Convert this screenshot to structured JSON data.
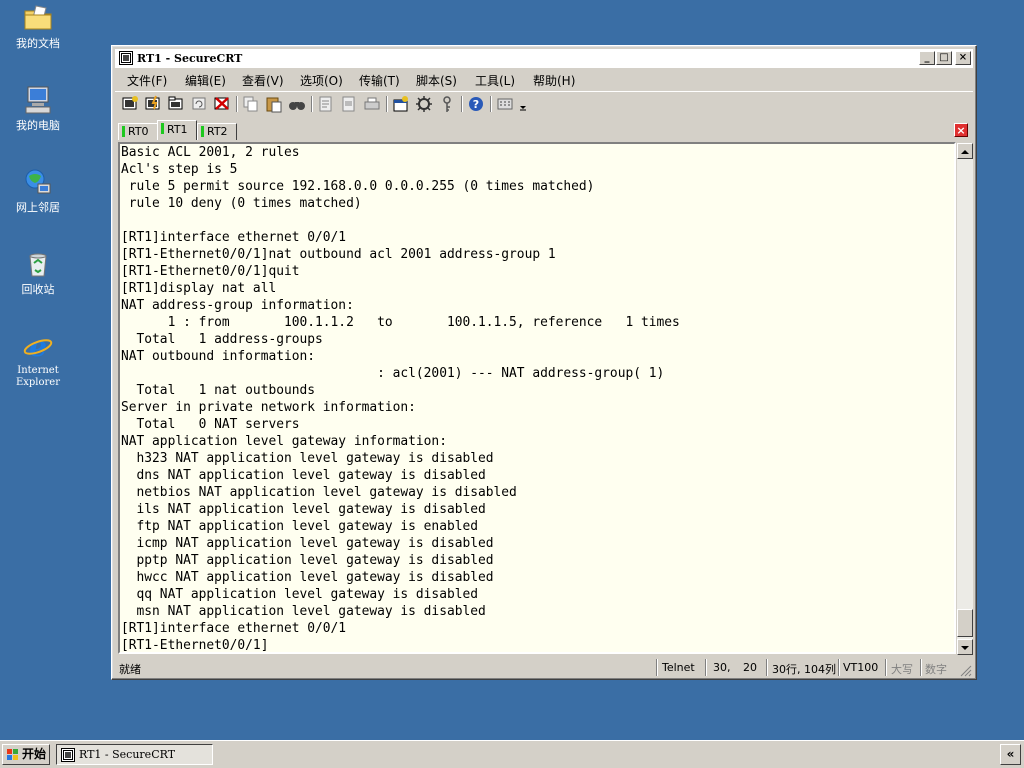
{
  "desktop": {
    "icons": [
      {
        "label": "我的文档"
      },
      {
        "label": "我的电脑"
      },
      {
        "label": "网上邻居"
      },
      {
        "label": "回收站"
      },
      {
        "label": "Internet",
        "label2": "Explorer"
      }
    ]
  },
  "window": {
    "title": "RT1 - SecureCRT",
    "controls": {
      "minimize": "_",
      "maximize": "□",
      "close": "×"
    }
  },
  "menu": [
    "文件(F)",
    "编辑(E)",
    "查看(V)",
    "选项(O)",
    "传输(T)",
    "脚本(S)",
    "工具(L)",
    "帮助(H)"
  ],
  "toolbar": [
    "connect-icon",
    "quick-connect-icon",
    "connect-tab-icon",
    "reconnect-icon",
    "disconnect-icon",
    "copy-icon",
    "paste-icon",
    "find-icon",
    "print-icon",
    "print-selection-icon",
    "printer-icon",
    "session-options-icon",
    "global-options-icon",
    "keymap-icon",
    "help-icon",
    "keypad-icon"
  ],
  "tabs": [
    {
      "label": "RT0",
      "active": false
    },
    {
      "label": "RT1",
      "active": true
    },
    {
      "label": "RT2",
      "active": false
    }
  ],
  "terminal": {
    "lines": [
      "Basic ACL 2001, 2 rules",
      "Acl's step is 5",
      " rule 5 permit source 192.168.0.0 0.0.0.255 (0 times matched)",
      " rule 10 deny (0 times matched)",
      "",
      "[RT1]interface ethernet 0/0/1",
      "[RT1-Ethernet0/0/1]nat outbound acl 2001 address-group 1",
      "[RT1-Ethernet0/0/1]quit",
      "[RT1]display nat all",
      "NAT address-group information:",
      "      1 : from       100.1.1.2   to       100.1.1.5, reference   1 times",
      "  Total   1 address-groups",
      "NAT outbound information:",
      "                                 : acl(2001) --- NAT address-group( 1)",
      "  Total   1 nat outbounds",
      "Server in private network information:",
      "  Total   0 NAT servers",
      "NAT application level gateway information:",
      "  h323 NAT application level gateway is disabled",
      "  dns NAT application level gateway is disabled",
      "  netbios NAT application level gateway is disabled",
      "  ils NAT application level gateway is disabled",
      "  ftp NAT application level gateway is enabled",
      "  icmp NAT application level gateway is disabled",
      "  pptp NAT application level gateway is disabled",
      "  hwcc NAT application level gateway is disabled",
      "  qq NAT application level gateway is disabled",
      "  msn NAT application level gateway is disabled",
      "[RT1]interface ethernet 0/0/1",
      "[RT1-Ethernet0/0/1]"
    ]
  },
  "status": {
    "ready": "就绪",
    "protocol": "Telnet",
    "cursor_row": "30,",
    "cursor_col": "20",
    "size": "30行, 104列",
    "emulation": "VT100",
    "caps": "大写",
    "num": "数字"
  },
  "taskbar": {
    "start_label": "开始",
    "task_label": "RT1 - SecureCRT",
    "tray_label": "«"
  }
}
